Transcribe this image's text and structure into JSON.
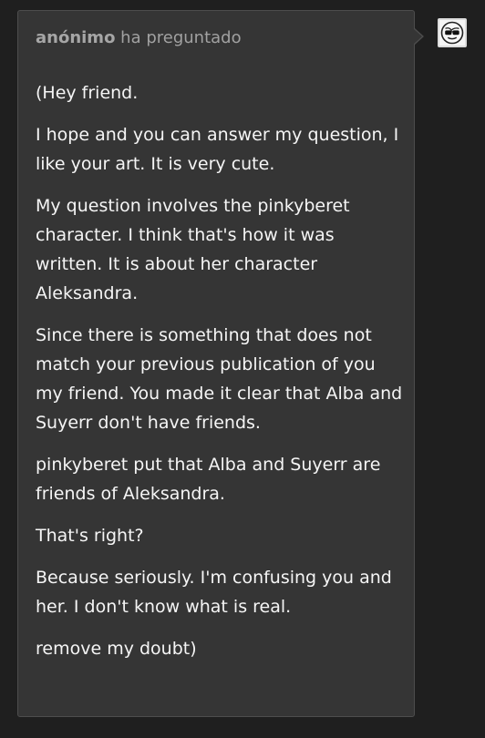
{
  "ask": {
    "sender": "anónimo",
    "action": "ha preguntado",
    "paragraphs": [
      "(Hey friend.",
      "I hope and you can answer my question, I like your art.  It is very cute.",
      "My question involves the pinkyberet character.  I think that's how it was written.  It is about her character Aleksandra.",
      "Since there is something that does not match your previous publication of you my friend.  You made it clear that Alba and Suyerr don't have friends.",
      "pinkyberet put that Alba and Suyerr are friends of Aleksandra.",
      "That's right?",
      "Because seriously.  I'm confusing you and her.  I don't know what is real.",
      "remove my doubt)"
    ]
  },
  "avatar": {
    "icon": "anonymous-sunglasses-face-icon"
  },
  "colors": {
    "page_background": "#1f1f1f",
    "card_background": "#353535",
    "card_border": "#4d4d4d",
    "header_text": "#aaaaaa",
    "body_text": "#f5f5f5"
  }
}
